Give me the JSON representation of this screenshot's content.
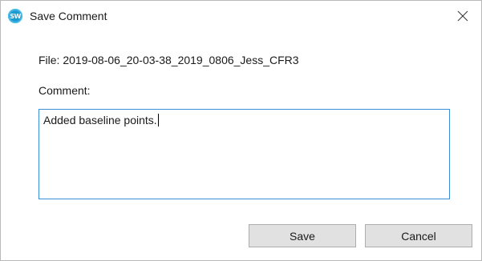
{
  "window": {
    "title": "Save Comment",
    "app_icon_text": "SW",
    "icon": "app-logo-icon"
  },
  "titlebar": {
    "close_icon": "close-icon"
  },
  "dialog": {
    "file_label": "File: 2019-08-06_20-03-38_2019_0806_Jess_CFR3",
    "comment_label": "Comment:",
    "comment_value": "Added baseline points."
  },
  "buttons": {
    "save_label": "Save",
    "cancel_label": "Cancel"
  },
  "colors": {
    "accent_border": "#3a8fd6",
    "button_bg": "#e1e1e1",
    "app_icon": "#1c9bd0"
  }
}
